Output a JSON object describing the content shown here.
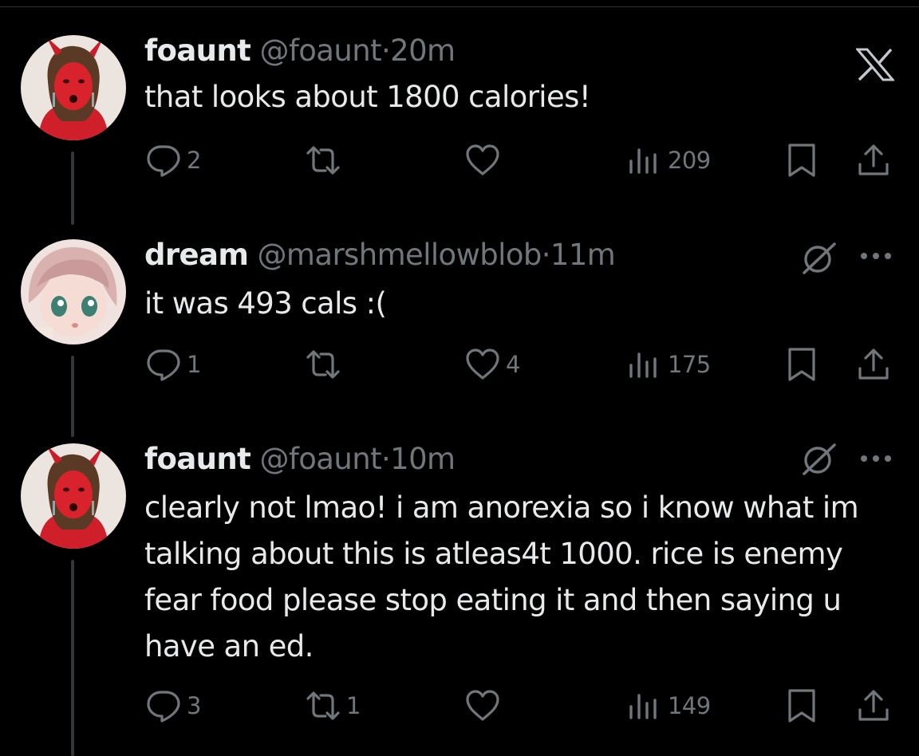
{
  "tweets": [
    {
      "name": "foaunt",
      "handle": "@foaunt",
      "separator": "·",
      "time": "20m",
      "text": "that looks about 1800 calories!",
      "corner_icon": "x-logo-icon",
      "actions": {
        "replies": "2",
        "reposts": "",
        "likes": "",
        "views": "209"
      }
    },
    {
      "name": "dream",
      "handle": "@marshmellowblob",
      "separator": "·",
      "time": "11m",
      "text": "it was 493 cals :(",
      "corner_icon": "grok-icon",
      "actions": {
        "replies": "1",
        "reposts": "",
        "likes": "4",
        "views": "175"
      }
    },
    {
      "name": "foaunt",
      "handle": "@foaunt",
      "separator": "·",
      "time": "10m",
      "text": "clearly not lmao! i am anorexia so i know what im talking about this is atleas4t 1000. rice is enemy fear food please stop eating it and then saying u have an ed.",
      "corner_icon": "grok-icon",
      "actions": {
        "replies": "3",
        "reposts": "1",
        "likes": "",
        "views": "149"
      }
    }
  ],
  "colors": {
    "background": "#000000",
    "text": "#e7e9ea",
    "secondary": "#71767b",
    "thread_line": "#333639"
  }
}
